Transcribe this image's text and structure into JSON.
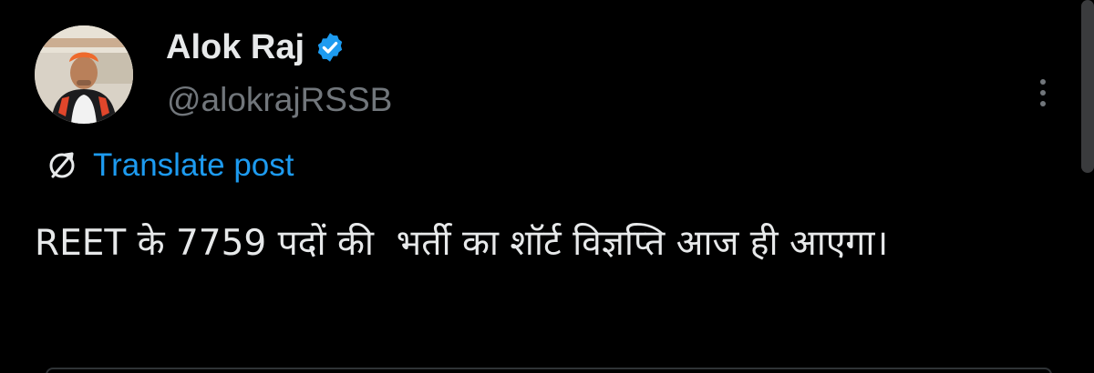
{
  "author": {
    "display_name": "Alok Raj",
    "handle": "@alokrajRSSB",
    "verified": true,
    "avatar_icon": "profile-photo"
  },
  "translate": {
    "label": "Translate post",
    "icon": "translate-icon"
  },
  "post": {
    "text": "REET के 7759 पदों की  भर्ती का शॉर्ट विज्ञप्ति आज ही आएगा।"
  },
  "colors": {
    "background": "#000000",
    "primary_text": "#e7e9ea",
    "secondary_text": "#71767b",
    "link": "#1d9bf0",
    "verified_badge": "#1d9bf0"
  }
}
